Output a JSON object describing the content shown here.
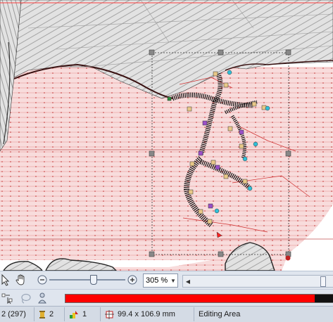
{
  "toolbar": {
    "zoom_value": "305 %",
    "zoom_minus": "−",
    "zoom_plus": "+"
  },
  "status": {
    "objects": "2 (297)",
    "color_count": "2",
    "sequence": "1",
    "size": "99.4 x 106.9 mm",
    "mode": "Editing Area"
  },
  "progress": {
    "fraction": 0.93,
    "bar_color": "#ff0000"
  },
  "colors": {
    "fill_pink": "#f6d6d6",
    "stitch_red": "#e24a4a",
    "gray_fill": "#dcdcdc"
  },
  "icons": [
    "pointer-icon",
    "hand-icon",
    "zoom-minus-icon",
    "zoom-plus-icon",
    "node-select-icon",
    "lasso-icon",
    "wizard-icon",
    "spool-icon",
    "sequence-icon",
    "size-icon"
  ]
}
